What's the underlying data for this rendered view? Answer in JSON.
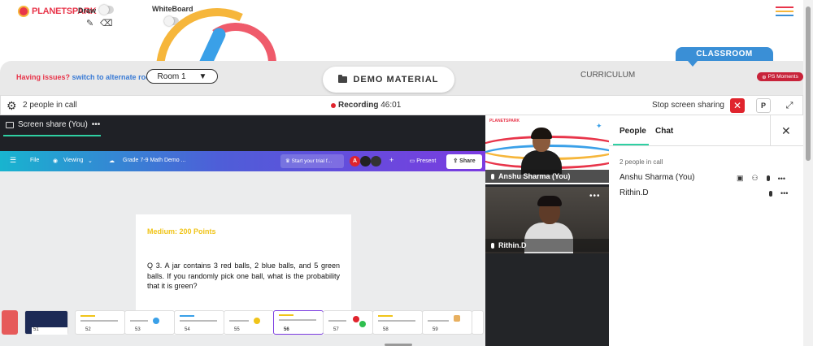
{
  "topbar": {
    "logo_text": "PLANETSPARK",
    "draw_label": "Draw",
    "whiteboard_label": "WhiteBoard"
  },
  "classroom_bar": {
    "issues_prefix": "Having issues?",
    "issues_link": "switch to alternate room",
    "room_value": "Room 1",
    "demo_material": "DEMO MATERIAL",
    "curriculum": "CURRICULUM",
    "classroom": "CLASSROOM",
    "ps_moments": "PS Moments"
  },
  "call_bar": {
    "people_count": "2 people in call",
    "recording_label": "Recording",
    "recording_time": "46:01",
    "stop_share": "Stop screen sharing",
    "p_label": "P"
  },
  "share": {
    "tab_label": "Screen share (You)",
    "canva": {
      "file": "File",
      "viewing": "Viewing",
      "doc_title": "Grade 7-9 Math Demo ...",
      "trial": "Start your trial f...",
      "avatar_initial": "A",
      "present": "Present",
      "share": "Share"
    },
    "slide": {
      "heading": "Medium: 200 Points",
      "question": "Q 3. A jar contains 3 red balls, 2 blue balls, and 5 green balls. If you randomly pick one ball, what is the probability that it is green?"
    },
    "thumbnails": [
      "51",
      "52",
      "53",
      "54",
      "55",
      "56",
      "57",
      "58",
      "59"
    ],
    "active_thumbnail": "56"
  },
  "videos": {
    "mini_logo": "PLANETSPARK",
    "participant1": "Anshu Sharma (You)",
    "participant2": "Rithin.D"
  },
  "panel": {
    "tab_people": "People",
    "tab_chat": "Chat",
    "count": "2 people in call",
    "people": [
      "Anshu Sharma (You)",
      "Rithin.D"
    ]
  },
  "colors": {
    "brand_red": "#e8354a",
    "accent_teal": "#2fd0a3",
    "classroom_blue": "#3a8fd6",
    "record_red": "#e0242d"
  }
}
